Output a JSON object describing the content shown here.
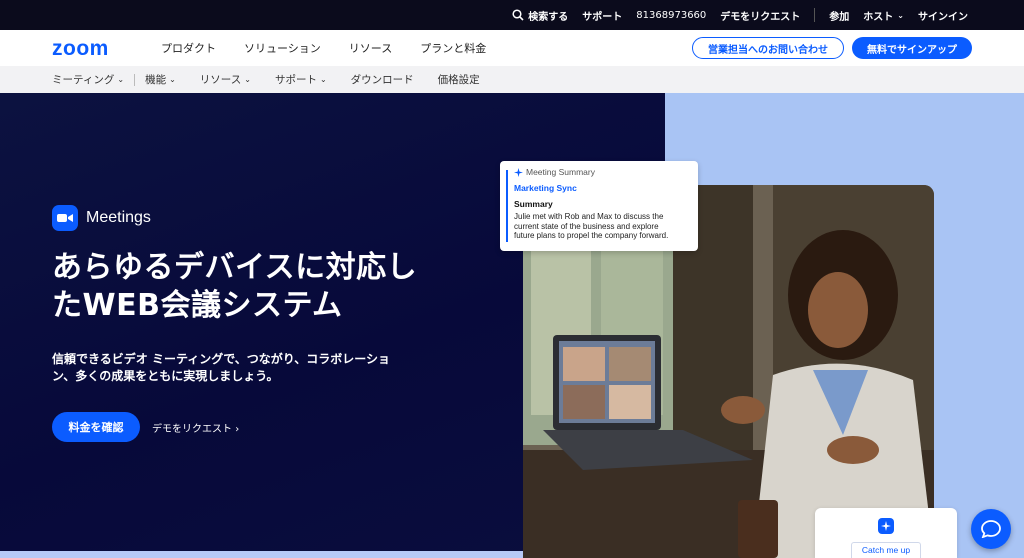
{
  "utility_bar": {
    "search_label": "検索する",
    "support": "サポート",
    "phone": "81368973660",
    "request_demo": "デモをリクエスト",
    "join": "参加",
    "host": "ホスト",
    "sign_in": "サインイン"
  },
  "main_nav": {
    "logo_text": "zoom",
    "items": [
      "プロダクト",
      "ソリューション",
      "リソース",
      "プランと料金"
    ],
    "contact_sales": "営業担当へのお問い合わせ",
    "signup_free": "無料でサインアップ"
  },
  "sub_nav": {
    "items": [
      {
        "label": "ミーティング",
        "dropdown": true
      },
      {
        "label": "機能",
        "dropdown": true
      },
      {
        "label": "リソース",
        "dropdown": true
      },
      {
        "label": "サポート",
        "dropdown": true
      },
      {
        "label": "ダウンロード",
        "dropdown": false
      },
      {
        "label": "価格設定",
        "dropdown": false
      }
    ]
  },
  "hero": {
    "product": "Meetings",
    "headline_line1": "あらゆるデバイスに対応し",
    "headline_line2": "たWEB会議システム",
    "desc_line1": "信頼できるビデオ ミーティングで、つながり、コラボレーショ",
    "desc_line2": "ン、多くの成果をともに実現しましょう。",
    "primary_button": "料金を確認",
    "secondary_link": "デモをリクエスト"
  },
  "summary_card": {
    "header": "Meeting Summary",
    "meeting_name": "Marketing Sync",
    "section": "Summary",
    "body_line1": "Julie met with Rob and Max to discuss the",
    "body_line2": "current state of the business and explore",
    "body_line3": "future plans to propel the company forward."
  },
  "catch_up": {
    "label": "Catch me up"
  },
  "colors": {
    "brand_blue": "#0B5CFF",
    "hero_dark": "#07093A",
    "hero_light": "#A9C4F4"
  }
}
